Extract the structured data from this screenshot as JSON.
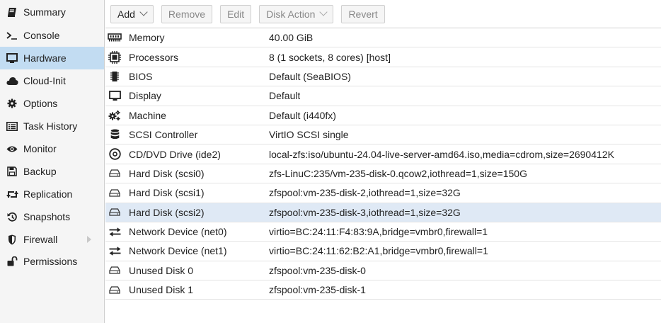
{
  "sidebar": {
    "items": [
      {
        "label": "Summary",
        "icon": "book-icon"
      },
      {
        "label": "Console",
        "icon": "terminal-icon"
      },
      {
        "label": "Hardware",
        "icon": "desktop-icon",
        "selected": true
      },
      {
        "label": "Cloud-Init",
        "icon": "cloud-icon"
      },
      {
        "label": "Options",
        "icon": "gear-icon"
      },
      {
        "label": "Task History",
        "icon": "list-icon"
      },
      {
        "label": "Monitor",
        "icon": "eye-icon"
      },
      {
        "label": "Backup",
        "icon": "floppy-icon"
      },
      {
        "label": "Replication",
        "icon": "retweet-icon"
      },
      {
        "label": "Snapshots",
        "icon": "history-icon"
      },
      {
        "label": "Firewall",
        "icon": "shield-icon",
        "has_submenu": true
      },
      {
        "label": "Permissions",
        "icon": "unlock-icon"
      }
    ]
  },
  "toolbar": {
    "add": "Add",
    "remove": "Remove",
    "edit": "Edit",
    "disk_action": "Disk Action",
    "revert": "Revert"
  },
  "hardware": {
    "rows": [
      {
        "name": "Memory",
        "value": "40.00 GiB",
        "icon": "memory-icon"
      },
      {
        "name": "Processors",
        "value": "8 (1 sockets, 8 cores) [host]",
        "icon": "cpu-icon"
      },
      {
        "name": "BIOS",
        "value": "Default (SeaBIOS)",
        "icon": "microchip-icon"
      },
      {
        "name": "Display",
        "value": "Default",
        "icon": "monitor-icon"
      },
      {
        "name": "Machine",
        "value": "Default (i440fx)",
        "icon": "cogs-icon"
      },
      {
        "name": "SCSI Controller",
        "value": "VirtIO SCSI single",
        "icon": "database-icon"
      },
      {
        "name": "CD/DVD Drive (ide2)",
        "value": "local-zfs:iso/ubuntu-24.04-live-server-amd64.iso,media=cdrom,size=2690412K",
        "icon": "cdrom-icon"
      },
      {
        "name": "Hard Disk (scsi0)",
        "value": "zfs-LinuC:235/vm-235-disk-0.qcow2,iothread=1,size=150G",
        "icon": "hdd-icon"
      },
      {
        "name": "Hard Disk (scsi1)",
        "value": "zfspool:vm-235-disk-2,iothread=1,size=32G",
        "icon": "hdd-icon"
      },
      {
        "name": "Hard Disk (scsi2)",
        "value": "zfspool:vm-235-disk-3,iothread=1,size=32G",
        "icon": "hdd-icon",
        "selected": true
      },
      {
        "name": "Network Device (net0)",
        "value": "virtio=BC:24:11:F4:83:9A,bridge=vmbr0,firewall=1",
        "icon": "exchange-icon"
      },
      {
        "name": "Network Device (net1)",
        "value": "virtio=BC:24:11:62:B2:A1,bridge=vmbr0,firewall=1",
        "icon": "exchange-icon"
      },
      {
        "name": "Unused Disk 0",
        "value": "zfspool:vm-235-disk-0",
        "icon": "hdd-icon"
      },
      {
        "name": "Unused Disk 1",
        "value": "zfspool:vm-235-disk-1",
        "icon": "hdd-icon"
      }
    ]
  }
}
